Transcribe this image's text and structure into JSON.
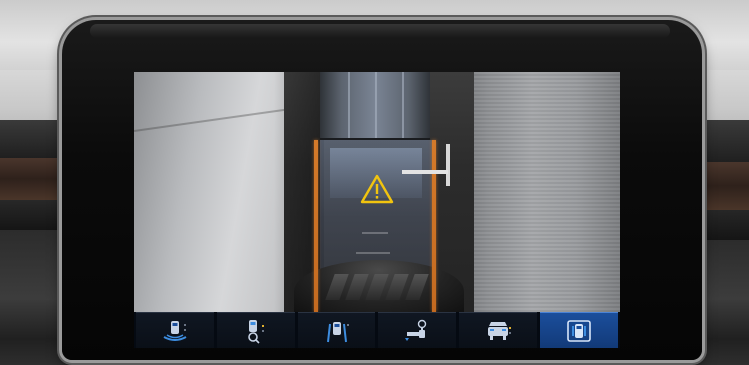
{
  "display": {
    "mode": "surround-view-camera",
    "warning_icon": "warning-triangle-icon"
  },
  "camera_views": {
    "active_index": 5,
    "items": [
      {
        "icon": "front-bird-eye-view-icon"
      },
      {
        "icon": "front-side-camera-zoom-icon"
      },
      {
        "icon": "front-parking-guidance-icon"
      },
      {
        "icon": "hitch-view-icon"
      },
      {
        "icon": "rear-camera-view-icon"
      },
      {
        "icon": "underbody-transparent-view-icon"
      }
    ]
  },
  "colors": {
    "guide_lines": "#d47a2a",
    "active_tab": "#1b4e9c",
    "warning": "#f1c40f",
    "toolbar_bg": "#050a12"
  }
}
